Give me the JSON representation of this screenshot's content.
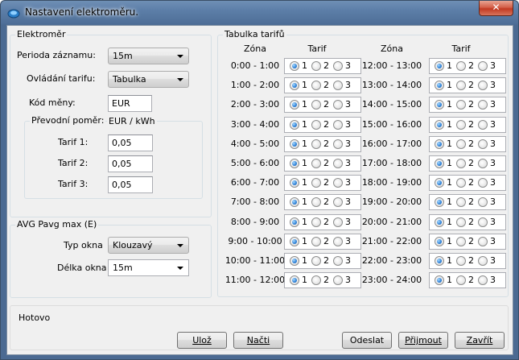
{
  "window": {
    "title": "Nastavení elektroměru."
  },
  "meter": {
    "group_title": "Elektroměr",
    "period_label": "Perioda záznamu:",
    "period_value": "15m",
    "tariff_control_label": "Ovládání tarifu:",
    "tariff_control_value": "Tabulka",
    "currency_label": "Kód měny:",
    "currency_value": "EUR",
    "conversion": {
      "group_title": "Převodní poměr:",
      "unit": "EUR / kWh",
      "tariffs": [
        {
          "label": "Tarif 1:",
          "value": "0,05"
        },
        {
          "label": "Tarif 2:",
          "value": "0,05"
        },
        {
          "label": "Tarif 3:",
          "value": "0,05"
        }
      ]
    }
  },
  "avg": {
    "group_title": "AVG Pavg max (E)",
    "window_type_label": "Typ okna",
    "window_type_value": "Klouzavý",
    "window_length_label": "Délka okna",
    "window_length_value": "15m"
  },
  "tariff_table": {
    "group_title": "Tabulka tarifů",
    "zone_header": "Zóna",
    "tariff_header": "Tarif",
    "option_labels": [
      "1",
      "2",
      "3"
    ],
    "rows_left": [
      {
        "zone": "0:00 - 1:00",
        "selected": 1
      },
      {
        "zone": "1:00 - 2:00",
        "selected": 1
      },
      {
        "zone": "2:00 - 3:00",
        "selected": 1
      },
      {
        "zone": "3:00 - 4:00",
        "selected": 1
      },
      {
        "zone": "4:00 - 5:00",
        "selected": 1
      },
      {
        "zone": "5:00 - 6:00",
        "selected": 1
      },
      {
        "zone": "6:00 - 7:00",
        "selected": 1
      },
      {
        "zone": "7:00 - 8:00",
        "selected": 1
      },
      {
        "zone": "8:00 - 9:00",
        "selected": 1
      },
      {
        "zone": "9:00 - 10:00",
        "selected": 1
      },
      {
        "zone": "10:00 - 11:00",
        "selected": 1
      },
      {
        "zone": "11:00 - 12:00",
        "selected": 1
      }
    ],
    "rows_right": [
      {
        "zone": "12:00 - 13:00",
        "selected": 1
      },
      {
        "zone": "13:00 - 14:00",
        "selected": 1
      },
      {
        "zone": "14:00 - 15:00",
        "selected": 1
      },
      {
        "zone": "15:00 - 16:00",
        "selected": 1
      },
      {
        "zone": "16:00 - 17:00",
        "selected": 1
      },
      {
        "zone": "17:00 - 18:00",
        "selected": 1
      },
      {
        "zone": "18:00 - 19:00",
        "selected": 1
      },
      {
        "zone": "19:00 - 20:00",
        "selected": 1
      },
      {
        "zone": "20:00 - 21:00",
        "selected": 1
      },
      {
        "zone": "21:00 - 22:00",
        "selected": 1
      },
      {
        "zone": "22:00 - 23:00",
        "selected": 1
      },
      {
        "zone": "23:00 - 24:00",
        "selected": 1
      }
    ]
  },
  "status": {
    "text": "Hotovo"
  },
  "buttons": {
    "save": "Ulož",
    "load": "Načti",
    "send": "Odeslat",
    "receive": "Přijmout",
    "close": "Zavřít"
  }
}
